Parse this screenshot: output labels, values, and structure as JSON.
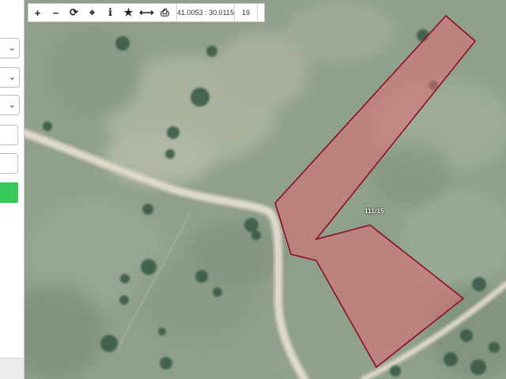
{
  "toolbar": {
    "buttons": [
      {
        "name": "zoom-in",
        "icon": "plus-icon",
        "glyph": "+"
      },
      {
        "name": "zoom-out",
        "icon": "minus-icon",
        "glyph": "−"
      },
      {
        "name": "refresh",
        "icon": "refresh-icon",
        "glyph": "⟳"
      },
      {
        "name": "locate",
        "icon": "crosshair-icon",
        "glyph": "⌖"
      },
      {
        "name": "info",
        "icon": "info-icon",
        "glyph": "i"
      },
      {
        "name": "favorite",
        "icon": "star-icon",
        "glyph": "★"
      },
      {
        "name": "measure",
        "icon": "measure-icon",
        "glyph": "⟷"
      },
      {
        "name": "print",
        "icon": "print-icon",
        "glyph": "⎙"
      }
    ],
    "coordinates": "41.0053 : 30.0115",
    "zoom_level": "19"
  },
  "parcel": {
    "label": "111/15",
    "fill_color": "#e06a74",
    "stroke_color": "#8c0f24"
  },
  "left_panel": {
    "accent_color": "#34c759"
  }
}
